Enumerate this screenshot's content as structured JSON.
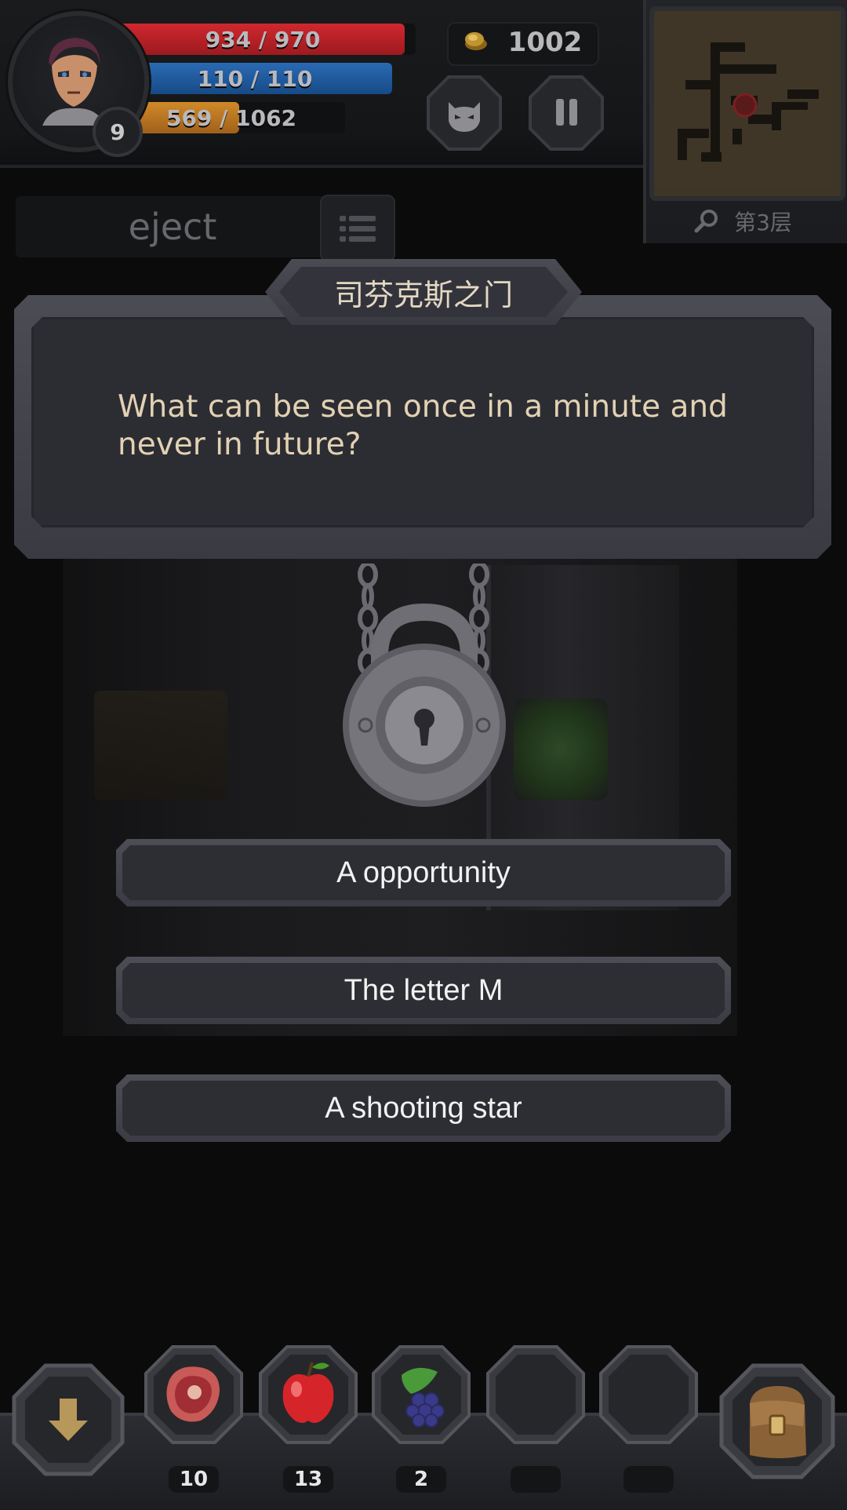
{
  "hud": {
    "level": "9",
    "hp_text": "934 / 970",
    "hp_ratio": 0.963,
    "mp_text": "110 / 110",
    "mp_ratio": 1.0,
    "xp_text": "569 / 1062",
    "xp_ratio": 0.536,
    "gold": "1002",
    "floor": "第3层"
  },
  "toolbar": {
    "eject_label": "eject"
  },
  "dialog": {
    "title": "司芬克斯之门",
    "question": "What can be seen once in a minute and never in future?"
  },
  "answers": [
    "A opportunity",
    "The letter M",
    "A shooting star"
  ],
  "inventory": [
    {
      "icon": "meat-icon",
      "count": "10"
    },
    {
      "icon": "apple-icon",
      "count": "13"
    },
    {
      "icon": "grapes-icon",
      "count": "2"
    },
    {
      "icon": "empty-slot",
      "count": ""
    },
    {
      "icon": "empty-slot",
      "count": ""
    }
  ],
  "colors": {
    "hp": "#c0202a",
    "mp": "#1e5aa0",
    "xp": "#c07a20",
    "dialog_text": "#e2d1b3"
  }
}
